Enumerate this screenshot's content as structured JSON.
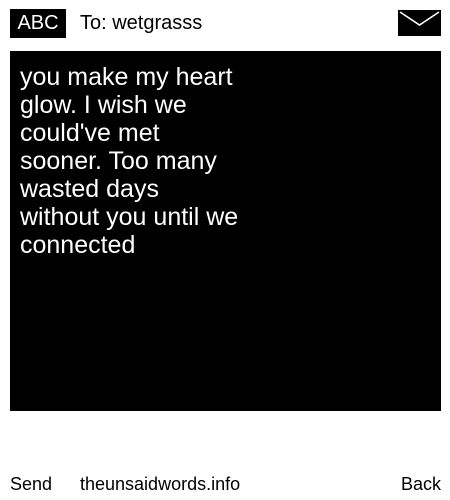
{
  "header": {
    "mode_label": "ABC",
    "recipient_label": "To: wetgrasss",
    "envelope_icon": "envelope-icon"
  },
  "message": {
    "body": "you make my heart glow. I wish we could've met sooner. Too many wasted days without you until we connected"
  },
  "footer": {
    "send_label": "Send",
    "site_link": "theunsaidwords.info",
    "back_label": "Back"
  },
  "colors": {
    "background": "#ffffff",
    "message_background": "#000000",
    "message_text": "#ffffff",
    "text": "#000000"
  }
}
